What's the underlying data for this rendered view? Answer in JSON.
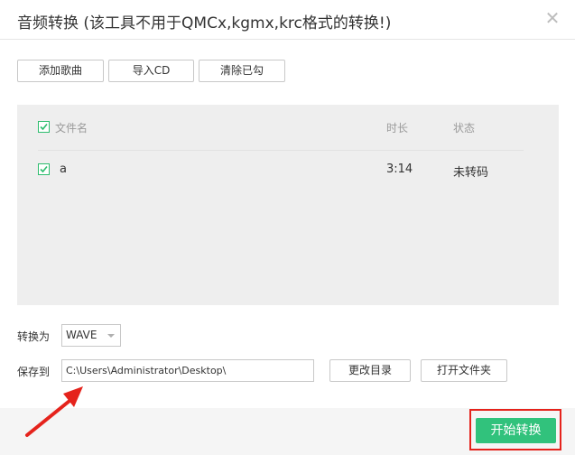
{
  "window": {
    "title": "音频转换 (该工具不用于QMCx,kgmx,krc格式的转换!)",
    "close_symbol": "✕"
  },
  "toolbar": {
    "add_song": "添加歌曲",
    "import_cd": "导入CD",
    "clear_checked": "清除已勾"
  },
  "table": {
    "headers": {
      "filename": "文件名",
      "duration": "时长",
      "status": "状态"
    },
    "rows": [
      {
        "checked": true,
        "filename": "a",
        "duration": "3:14",
        "status": "未转码"
      }
    ]
  },
  "convert": {
    "label": "转换为",
    "format_value": "WAVE"
  },
  "save": {
    "label": "保存到",
    "path_value": "C:\\Users\\Administrator\\Desktop\\",
    "change_dir": "更改目录",
    "open_folder": "打开文件夹"
  },
  "footer": {
    "start_button": "开始转换"
  },
  "colors": {
    "accent_green": "#31c27c",
    "annotation_red": "#e5231c"
  },
  "icons": {
    "close": "close-icon",
    "check": "checkmark-icon",
    "dropdown": "chevron-down-icon",
    "annotation": "red-arrow-annotation"
  }
}
